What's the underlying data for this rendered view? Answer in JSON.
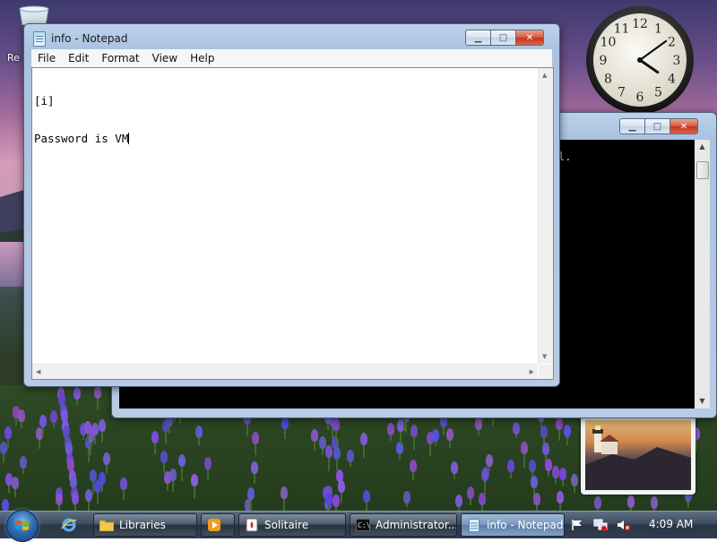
{
  "desktop": {
    "recycle_bin_label": "Re"
  },
  "clock": {
    "numerals": [
      "12",
      "1",
      "2",
      "3",
      "4",
      "5",
      "6",
      "7",
      "8",
      "9",
      "10",
      "11"
    ],
    "time": {
      "hour": 4,
      "minute": 9
    }
  },
  "cmd_window": {
    "console_text": "l."
  },
  "notepad": {
    "title": "info - Notepad",
    "menu": [
      "File",
      "Edit",
      "Format",
      "View",
      "Help"
    ],
    "content": [
      "[i]",
      "Password is VM"
    ]
  },
  "taskbar": {
    "buttons": [
      {
        "label": "Libraries",
        "icon": "folder-icon"
      },
      {
        "label": "",
        "icon": "media-player-icon"
      },
      {
        "label": "Solitaire",
        "icon": "solitaire-icon"
      },
      {
        "label": "Administrator...",
        "icon": "cmd-icon"
      },
      {
        "label": "info - Notepad",
        "icon": "notepad-icon",
        "active": true
      }
    ],
    "time": "4:09 AM"
  },
  "colors": {
    "accent": "#2f6db4",
    "close_button": "#c2361b",
    "console_bg": "#000000"
  }
}
